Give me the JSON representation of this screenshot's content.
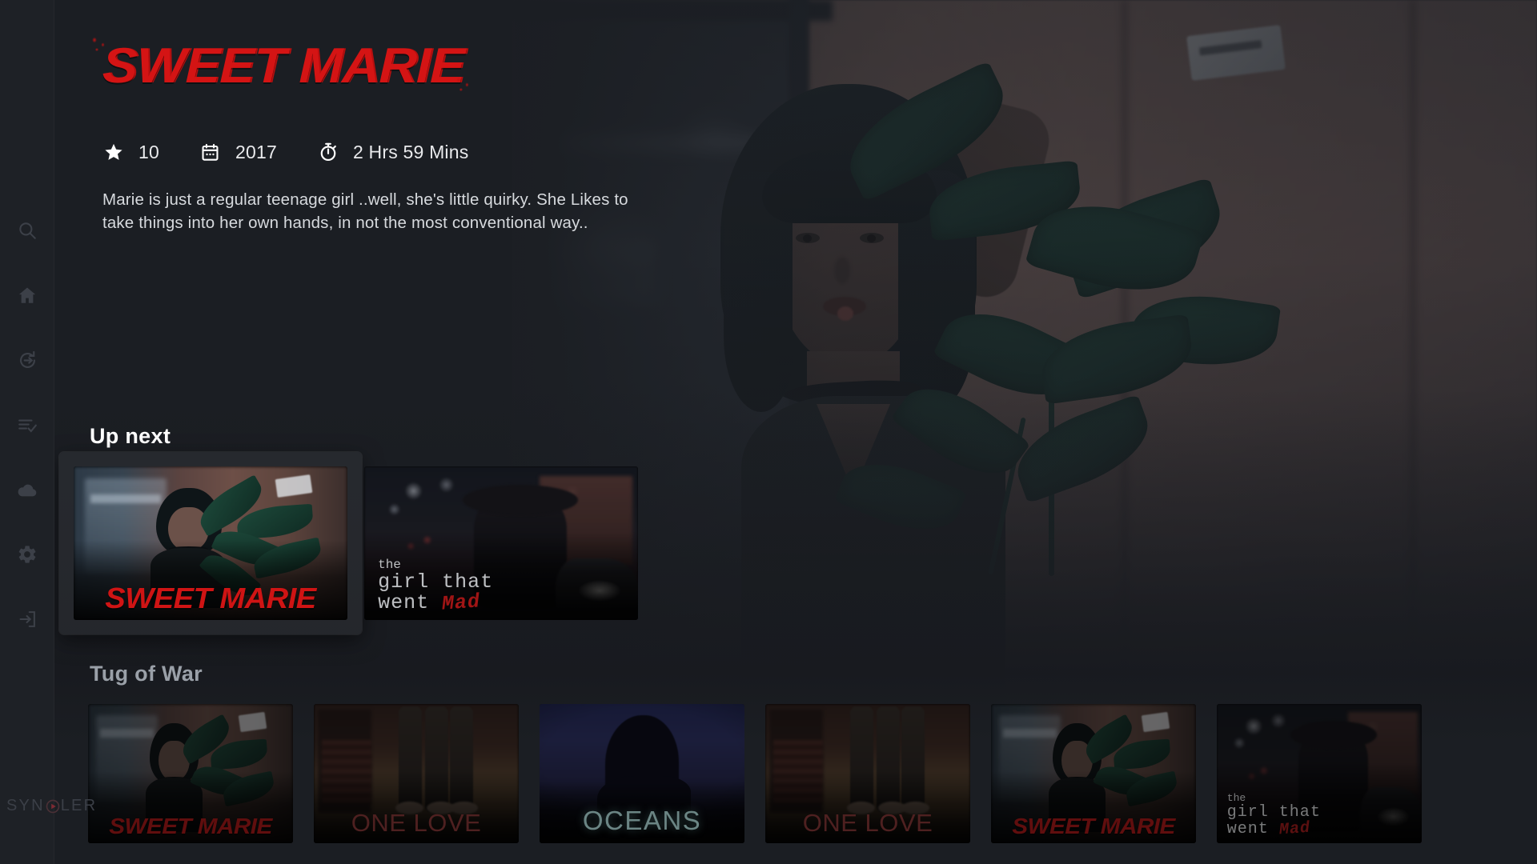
{
  "app": {
    "brand_name": "SYN",
    "brand_name_tail": "LER",
    "brand_logo_icon": "play-circle-icon",
    "background_color": "#1b1e23",
    "accent_color": "#d41414"
  },
  "sidebar": {
    "items": [
      {
        "name": "search",
        "icon": "search-icon",
        "label": "Search"
      },
      {
        "name": "home",
        "icon": "home-icon",
        "label": "Home"
      },
      {
        "name": "resume",
        "icon": "replay-arrow-icon",
        "label": "Resume"
      },
      {
        "name": "playlist",
        "icon": "playlist-check-icon",
        "label": "My List"
      },
      {
        "name": "cloud",
        "icon": "cloud-icon",
        "label": "Cloud"
      },
      {
        "name": "settings",
        "icon": "gear-icon",
        "label": "Settings"
      },
      {
        "name": "logout",
        "icon": "logout-icon",
        "label": "Sign out"
      }
    ]
  },
  "detail": {
    "title": "SWEET MARIE",
    "title_color": "#d41414",
    "meta": [
      {
        "icon": "star-icon",
        "value": "10"
      },
      {
        "icon": "calendar-icon",
        "value": "2017"
      },
      {
        "icon": "stopwatch-icon",
        "value": "2 Hrs 59 Mins"
      }
    ],
    "synopsis": "Marie is just a regular teenage girl ..well, she's  little quirky. She Likes to take things into her own hands, in not the most conventional way.."
  },
  "rows": [
    {
      "id": "up-next",
      "title": "Up next",
      "title_style": "bright",
      "cards": [
        {
          "title": "SWEET MARIE",
          "art": "sweet-marie",
          "selected": true
        },
        {
          "title": "the girl that went Mad",
          "art": "girl-that-went-mad",
          "selected": false,
          "lines": {
            "l1": "the",
            "l2": "girl that",
            "l3": "went",
            "l4": "Mad"
          }
        }
      ]
    },
    {
      "id": "tug-of-war",
      "title": "Tug of War",
      "title_style": "muted",
      "cards": [
        {
          "title": "SWEET MARIE",
          "art": "sweet-marie",
          "selected": false
        },
        {
          "title": "ONE LOVE",
          "art": "one-love",
          "selected": false
        },
        {
          "title": "OCEANS",
          "art": "oceans",
          "selected": false
        },
        {
          "title": "ONE LOVE",
          "art": "one-love",
          "selected": false
        },
        {
          "title": "SWEET MARIE",
          "art": "sweet-marie",
          "selected": false
        },
        {
          "title": "the girl that went Mad",
          "art": "girl-that-went-mad",
          "selected": false,
          "lines": {
            "l1": "the",
            "l2": "girl that",
            "l3": "went",
            "l4": "Mad"
          }
        }
      ]
    }
  ]
}
